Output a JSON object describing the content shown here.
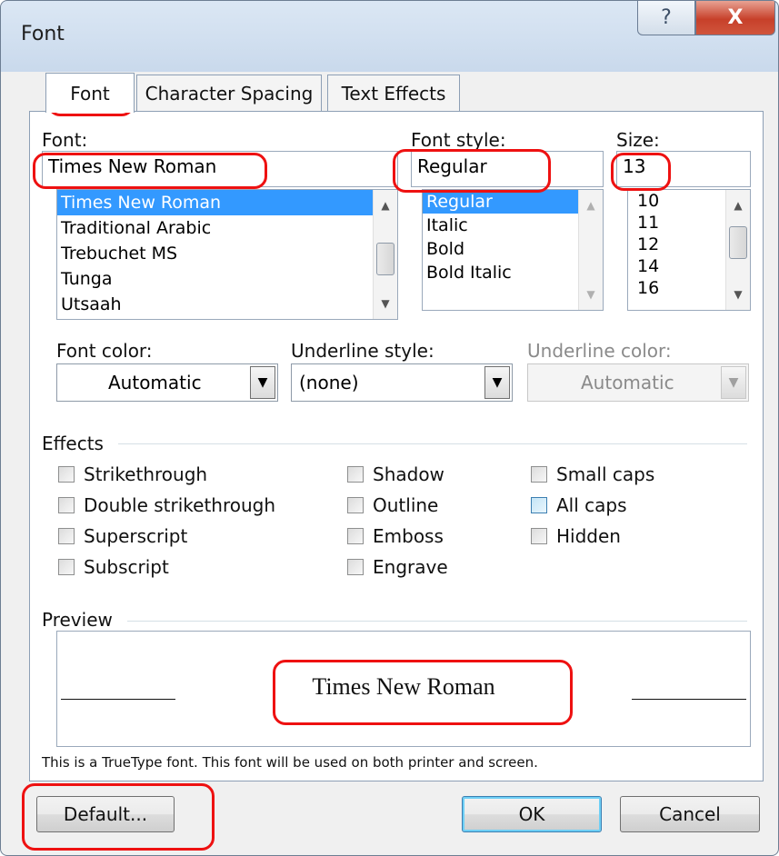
{
  "window": {
    "title": "Font",
    "help_glyph": "?",
    "close_glyph": "X"
  },
  "tabs": [
    {
      "label": "Font",
      "active": true
    },
    {
      "label": "Character Spacing",
      "active": false
    },
    {
      "label": "Text Effects",
      "active": false
    }
  ],
  "font": {
    "label": "Font:",
    "value": "Times New Roman",
    "items": [
      "Times New Roman",
      "Traditional Arabic",
      "Trebuchet MS",
      "Tunga",
      "Utsaah"
    ],
    "selected_index": 0
  },
  "font_style": {
    "label": "Font style:",
    "value": "Regular",
    "items": [
      "Regular",
      "Italic",
      "Bold",
      "Bold Italic"
    ],
    "selected_index": 0
  },
  "size": {
    "label": "Size:",
    "value": "13",
    "items": [
      "10",
      "11",
      "12",
      "14",
      "16"
    ]
  },
  "font_color": {
    "label": "Font color:",
    "value": "Automatic"
  },
  "underline_style": {
    "label": "Underline style:",
    "value": "(none)"
  },
  "underline_color": {
    "label": "Underline color:",
    "value": "Automatic",
    "disabled": true
  },
  "effects": {
    "label": "Effects",
    "col1": [
      "Strikethrough",
      "Double strikethrough",
      "Superscript",
      "Subscript"
    ],
    "col2": [
      "Shadow",
      "Outline",
      "Emboss",
      "Engrave"
    ],
    "col3": [
      "Small caps",
      "All caps",
      "Hidden"
    ]
  },
  "preview": {
    "label": "Preview",
    "text": "Times New Roman",
    "note": "This is a TrueType font. This font will be used on both printer and screen."
  },
  "buttons": {
    "default": "Default...",
    "ok": "OK",
    "cancel": "Cancel"
  },
  "colors": {
    "selection": "#3399ff",
    "annotation": "#e11111",
    "close": "#c7402a"
  }
}
